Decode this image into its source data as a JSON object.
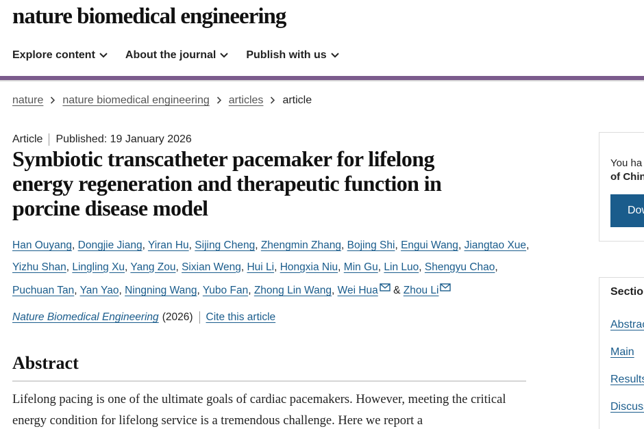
{
  "header": {
    "logo_text": "nature biomedical engineering",
    "nav": [
      {
        "label": "Explore content"
      },
      {
        "label": "About the journal"
      },
      {
        "label": "Publish with us"
      }
    ]
  },
  "breadcrumb": {
    "items": [
      "nature",
      "nature biomedical engineering",
      "articles"
    ],
    "current": "article"
  },
  "article": {
    "type": "Article",
    "published": "Published: 19 January 2026",
    "title": "Symbiotic transcatheter pacemaker for lifelong energy regeneration and therapeutic function in porcine disease model",
    "authors": [
      "Han Ouyang",
      "Dongjie Jiang",
      "Yiran Hu",
      "Sijing Cheng",
      "Zhengmin Zhang",
      "Bojing Shi",
      "Engui Wang",
      "Jiangtao Xue",
      "Yizhu Shan",
      "Lingling Xu",
      "Yang Zou",
      "Sixian Weng",
      "Hui Li",
      "Hongxia Niu",
      "Min Gu",
      "Lin Luo",
      "Shengyu Chao",
      "Puchuan Tan",
      "Yan Yao",
      "Ningning Wang",
      "Yubo Fan",
      "Zhong Lin Wang",
      "Wei Hua",
      "Zhou Li"
    ],
    "author_joiner": "&",
    "journal": "Nature Biomedical Engineering",
    "year": "(2026)",
    "cite_label": "Cite this article"
  },
  "abstract": {
    "heading": "Abstract",
    "text": "Lifelong pacing is one of the ultimate goals of cardiac pacemakers. However, meeting the critical energy condition for lifelong service is a tremendous challenge. Here we report a"
  },
  "sidebar": {
    "access_line1": "You ha",
    "access_line2": "of Chin",
    "download_label": "Dow",
    "sections_title": "Section",
    "sections": [
      "Abstrac",
      "Main",
      "Results",
      "Discuss"
    ]
  },
  "colors": {
    "accent_purple": "#7b5b8c",
    "link_blue": "#1a5c8c"
  },
  "icons": [
    "chevron-down-icon",
    "chevron-right-icon",
    "mail-icon"
  ]
}
